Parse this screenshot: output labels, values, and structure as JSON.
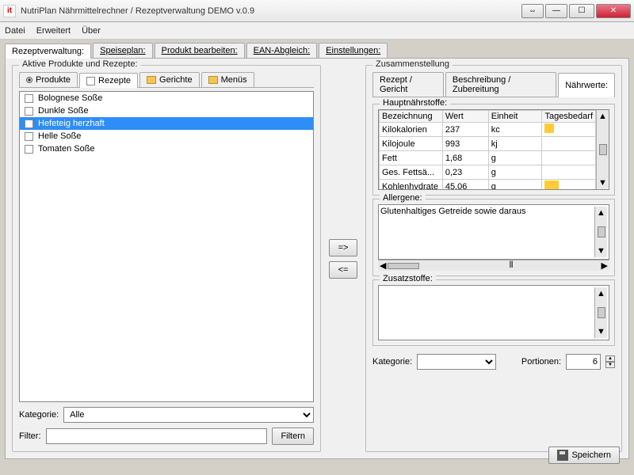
{
  "window": {
    "title": "NutriPlan Nährmittelrechner / Rezeptverwaltung DEMO v.0.9",
    "icon_text": "it"
  },
  "menu": {
    "datei": "Datei",
    "erweitert": "Erweitert",
    "uber": "Über"
  },
  "tabs": {
    "rezept": "Rezeptverwaltung:",
    "speise": "Speiseplan:",
    "produkt": "Produkt bearbeiten:",
    "ean": "EAN-Abgleich:",
    "einst": "Einstellungen:"
  },
  "left": {
    "legend": "Aktive Produkte und Rezepte:",
    "tabs": {
      "produkte": "Produkte",
      "rezepte": "Rezepte",
      "gerichte": "Gerichte",
      "menus": "Menüs"
    },
    "items": [
      "Bolognese Soße",
      "Dunkle Soße",
      "Hefeteig herzhaft",
      "Helle Soße",
      "Tomaten Soße"
    ],
    "selected_index": 2,
    "kategorie_label": "Kategorie:",
    "kategorie_value": "Alle",
    "filter_label": "Filter:",
    "filter_btn": "Filtern"
  },
  "mid": {
    "right": "=>",
    "left": "<="
  },
  "right": {
    "legend": "Zusammenstellung",
    "tabs": {
      "rezept": "Rezept / Gericht",
      "beschr": "Beschreibung / Zubereitung",
      "nahr": "Nährwerte:"
    },
    "haupt_label": "Hauptnährstoffe:",
    "cols": {
      "bez": "Bezeichnung",
      "wert": "Wert",
      "einheit": "Einheit",
      "tag": "Tagesbedarf"
    },
    "rows": [
      {
        "b": "Kilokalorien",
        "w": "237",
        "e": "kc",
        "bar": 12
      },
      {
        "b": "Kilojoule",
        "w": "993",
        "e": "kj",
        "bar": 0
      },
      {
        "b": "Fett",
        "w": "1,68",
        "e": "g",
        "bar": 0
      },
      {
        "b": "Ges. Fettsä...",
        "w": "0,23",
        "e": "g",
        "bar": 0
      },
      {
        "b": "Kohlenhydrate",
        "w": "45,06",
        "e": "g",
        "bar": 18
      }
    ],
    "allergene_label": "Allergene:",
    "allergene_text": "Glutenhaltiges Getreide sowie daraus",
    "zusatz_label": "Zusatzstoffe:",
    "kategorie_label": "Kategorie:",
    "portionen_label": "Portionen:",
    "portionen_value": "6"
  },
  "save": "Speichern"
}
